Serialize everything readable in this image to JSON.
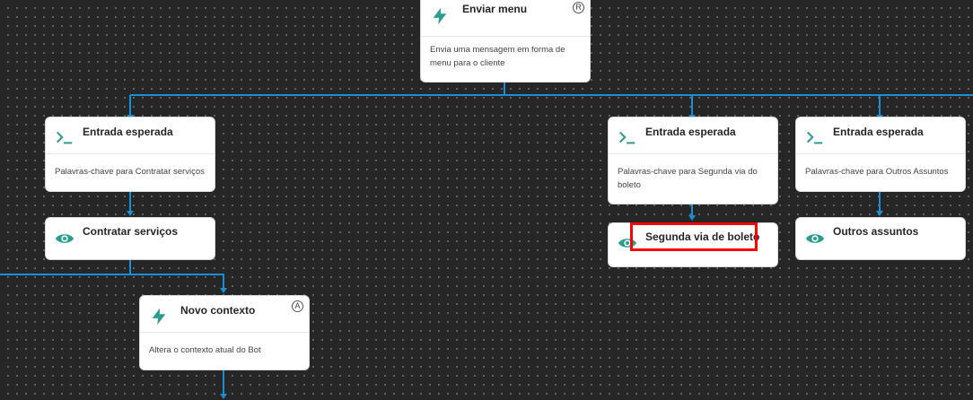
{
  "nodes": {
    "enviar_menu": {
      "title": "Enviar menu",
      "badge": "R",
      "description": "Envia uma mensagem em forma de menu para o cliente"
    },
    "entrada_1": {
      "title": "Entrada esperada",
      "description": "Palavras-chave para Contratar serviços"
    },
    "entrada_2": {
      "title": "Entrada esperada",
      "description": "Palavras-chave para Segunda via do boleto"
    },
    "entrada_3": {
      "title": "Entrada esperada",
      "description": "Palavras-chave para Outros Assuntos"
    },
    "contratar": {
      "title": "Contratar serviços"
    },
    "segunda_via": {
      "title": "Segunda via de boleto"
    },
    "outros": {
      "title": "Outros assuntos"
    },
    "novo_contexto": {
      "title": "Novo contexto",
      "badge": "A",
      "description": "Altera o contexto atual do Bot"
    }
  },
  "colors": {
    "connector": "#1a8fd6",
    "icon": "#2a9d8f",
    "highlight": "#ff0000",
    "background": "#262626"
  },
  "icons": {
    "action": "lightning-icon",
    "input": "terminal-prompt-icon",
    "view": "eye-icon"
  }
}
